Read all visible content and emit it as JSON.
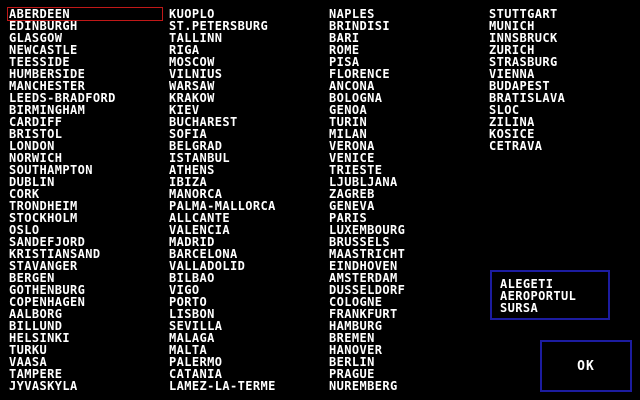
{
  "colors": {
    "background": "#000000",
    "text": "#ffffff",
    "selection_border": "#c01818",
    "panel_border": "#1c1ca0"
  },
  "selected_city": "ABERDEEN",
  "cities": {
    "col1": [
      "ABERDEEN",
      "EDINBURGH",
      "GLASGOW",
      "NEWCASTLE",
      "TEESSIDE",
      "HUMBERSIDE",
      "MANCHESTER",
      "LEEDS-BRADFORD",
      "BIRMINGHAM",
      "CARDIFF",
      "BRISTOL",
      "LONDON",
      "NORWICH",
      "SOUTHAMPTON",
      "DUBLIN",
      "CORK",
      "TRONDHEIM",
      "STOCKHOLM",
      "OSLO",
      "SANDEFJORD",
      "KRISTIANSAND",
      "STAVANGER",
      "BERGEN",
      "GOTHENBURG",
      "COPENHAGEN",
      "AALBORG",
      "BILLUND",
      "HELSINKI",
      "TURKU",
      "VAASA",
      "TAMPERE",
      "JYVASKYLA"
    ],
    "col2": [
      "KUOPLO",
      "ST.PETERSBURG",
      "TALLINN",
      "RIGA",
      "MOSCOW",
      "VILNIUS",
      "WARSAW",
      "KRAKOW",
      "KIEV",
      "BUCHAREST",
      "SOFIA",
      "BELGRAD",
      "ISTANBUL",
      "ATHENS",
      "IBIZA",
      "MANORCA",
      "PALMA-MALLORCA",
      "ALLCANTE",
      "VALENCIA",
      "MADRID",
      "BARCELONA",
      "VALLADOLID",
      "BILBAO",
      "VIGO",
      "PORTO",
      "LISBON",
      "SEVILLA",
      "MALAGA",
      "MALTA",
      "PALERMO",
      "CATANIA",
      "LAMEZ-LA-TERME"
    ],
    "col3": [
      "NAPLES",
      "BRINDISI",
      "BARI",
      "ROME",
      "PISA",
      "FLORENCE",
      "ANCONA",
      "BOLOGNA",
      "GENOA",
      "TURIN",
      "MILAN",
      "VERONA",
      "VENICE",
      "TRIESTE",
      "LJUBLJANA",
      "ZAGREB",
      "GENEVA",
      "PARIS",
      "LUXEMBOURG",
      "BRUSSELS",
      "MAASTRICHT",
      "EINDHOVEN",
      "AMSTERDAM",
      "DUSSELDORF",
      "COLOGNE",
      "FRANKFURT",
      "HAMBURG",
      "BREMEN",
      "HANOVER",
      "BERLIN",
      "PRAGUE",
      "NUREMBERG"
    ],
    "col4": [
      "STUTTGART",
      "MUNICH",
      "INNSBRUCK",
      "ZURICH",
      "STRASBURG",
      "VIENNA",
      "BUDAPEST",
      "BRATISLAVA",
      "SLOC",
      "ZILINA",
      "KOSICE",
      "CETRAVA"
    ]
  },
  "info_panel": {
    "line1": "ALEGETI",
    "line2": "AEROPORTUL",
    "line3": "SURSA"
  },
  "ok_button": {
    "label": "OK"
  }
}
